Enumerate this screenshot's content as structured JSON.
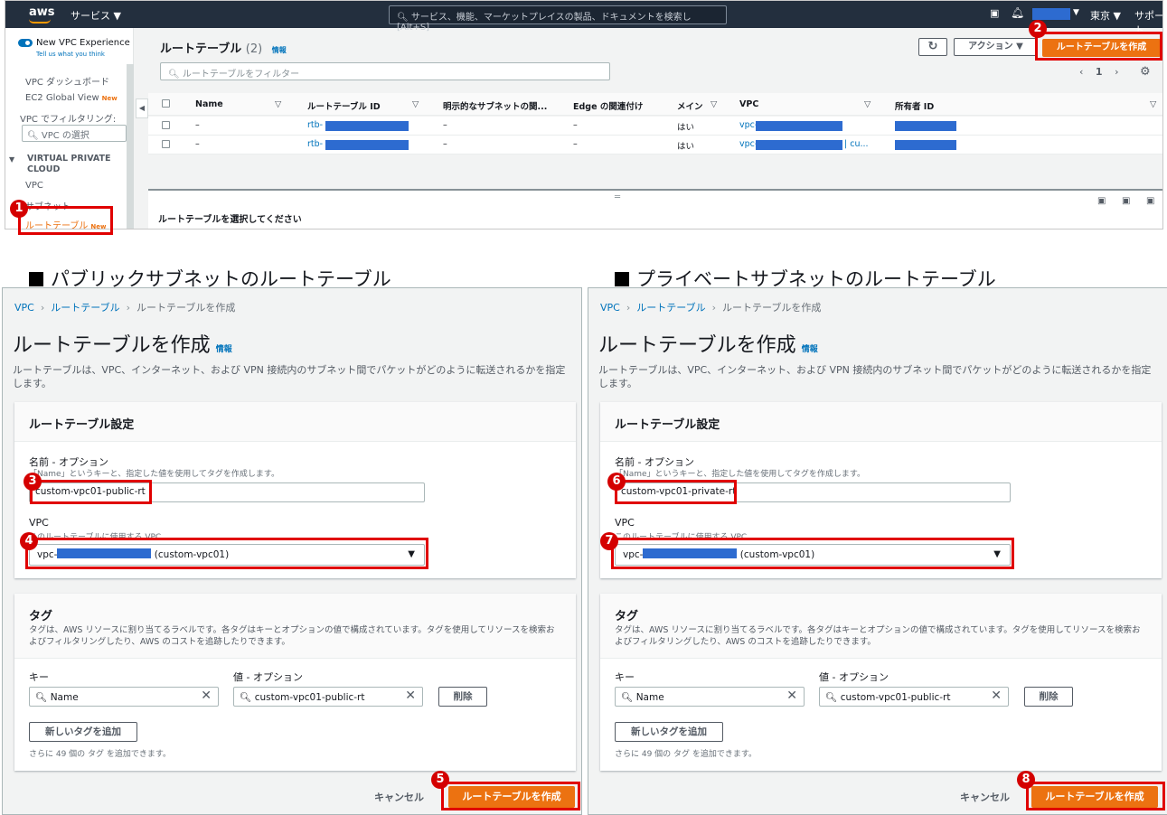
{
  "topnav": {
    "logo": "aws",
    "services": "サービス ▼",
    "search_placeholder": "サービス、機能、マーケットプレイスの製品、ドキュメントを検索し　[Alt+S]",
    "region": "東京 ▼",
    "support": "サポート"
  },
  "sidebar": {
    "new_experience": "New VPC Experience",
    "tell_us": "Tell us what you think",
    "dashboard": "VPC ダッシュボード",
    "global_view": "EC2 Global View",
    "new_badge": "New",
    "filter_label": "VPC でフィルタリング:",
    "filter_placeholder": "VPC の選択",
    "group": "VIRTUAL PRIVATE CLOUD",
    "vpc": "VPC",
    "subnet": "サブネット",
    "route_table": "ルートテーブル"
  },
  "list": {
    "title": "ルートテーブル",
    "count": "(2)",
    "info": "情報",
    "actions": "アクション ▼",
    "create_button": "ルートテーブルを作成",
    "filter_placeholder": "ルートテーブルをフィルター",
    "page": "1",
    "columns": [
      "Name",
      "ルートテーブル ID",
      "明示的なサブネットの関...",
      "Edge の関連付け",
      "メイン",
      "VPC",
      "所有者 ID"
    ],
    "rows": [
      {
        "name": "–",
        "id_prefix": "rtb-",
        "subnet": "–",
        "edge": "–",
        "main": "はい",
        "vpc_prefix": "vpc-",
        "vpc_suffix": ""
      },
      {
        "name": "–",
        "id_prefix": "rtb-",
        "subnet": "–",
        "edge": "–",
        "main": "はい",
        "vpc_prefix": "vpc-",
        "vpc_suffix": "| cu..."
      }
    ],
    "footer": "ルートテーブルを選択してください"
  },
  "headings": {
    "public": "パブリックサブネットのルートテーブル",
    "private": "プライベートサブネットのルートテーブル"
  },
  "form": {
    "crumb_vpc": "VPC",
    "crumb_rt": "ルートテーブル",
    "crumb_create": "ルートテーブルを作成",
    "title": "ルートテーブルを作成",
    "info": "情報",
    "description": "ルートテーブルは、VPC、インターネット、および VPN 接続内のサブネット間でパケットがどのように転送されるかを指定します。",
    "settings_title": "ルートテーブル設定",
    "name_label": "名前 - オプション",
    "name_hint": "「Name」というキーと、指定した値を使用してタグを作成します。",
    "vpc_label": "VPC",
    "vpc_hint": "このルートテーブルに使用する VPC。",
    "vpc_prefix": "vpc-",
    "vpc_suffix": "(custom-vpc01)",
    "tags_title": "タグ",
    "tags_desc": "タグは、AWS リソースに割り当てるラベルです。各タグはキーとオプションの値で構成されています。タグを使用してリソースを検索およびフィルタリングしたり、AWS のコストを追跡したりできます。",
    "key_label": "キー",
    "value_label": "値 - オプション",
    "key_value": "Name",
    "tag_value": "custom-vpc01-public-rt",
    "remove": "削除",
    "add_tag": "新しいタグを追加",
    "tag_limit": "さらに 49 個の タグ を追加できます。",
    "cancel": "キャンセル",
    "create": "ルートテーブルを作成"
  },
  "public_form": {
    "name_value": "custom-vpc01-public-rt"
  },
  "private_form": {
    "name_value": "custom-vpc01-private-rt"
  },
  "badges": [
    "1",
    "2",
    "3",
    "4",
    "5",
    "6",
    "7",
    "8"
  ],
  "colors": {
    "accent": "#ec7211",
    "link": "#0073bb",
    "highlight": "#e00000",
    "nav": "#232f3e"
  }
}
